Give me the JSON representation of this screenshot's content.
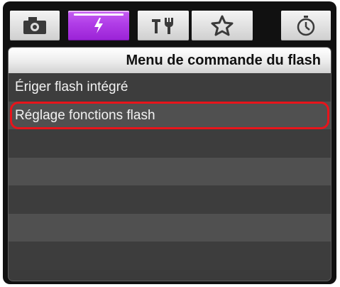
{
  "tabs": [
    {
      "icon": "camera-icon",
      "active": false
    },
    {
      "icon": "flash-icon",
      "active": true
    },
    {
      "icon": "tools-icon",
      "active": false
    },
    {
      "icon": "star-icon",
      "active": false
    },
    {
      "icon": "timer-icon",
      "active": false
    }
  ],
  "menu": {
    "title": "Menu de commande du flash",
    "items": [
      {
        "label": "Ériger flash intégré"
      },
      {
        "label": "Réglage fonctions flash",
        "highlighted": true
      },
      {
        "label": ""
      },
      {
        "label": ""
      },
      {
        "label": ""
      },
      {
        "label": ""
      },
      {
        "label": ""
      }
    ]
  },
  "colors": {
    "active_tab": "#b23fe8",
    "highlight": "#e8141b",
    "frame": "#111111"
  }
}
